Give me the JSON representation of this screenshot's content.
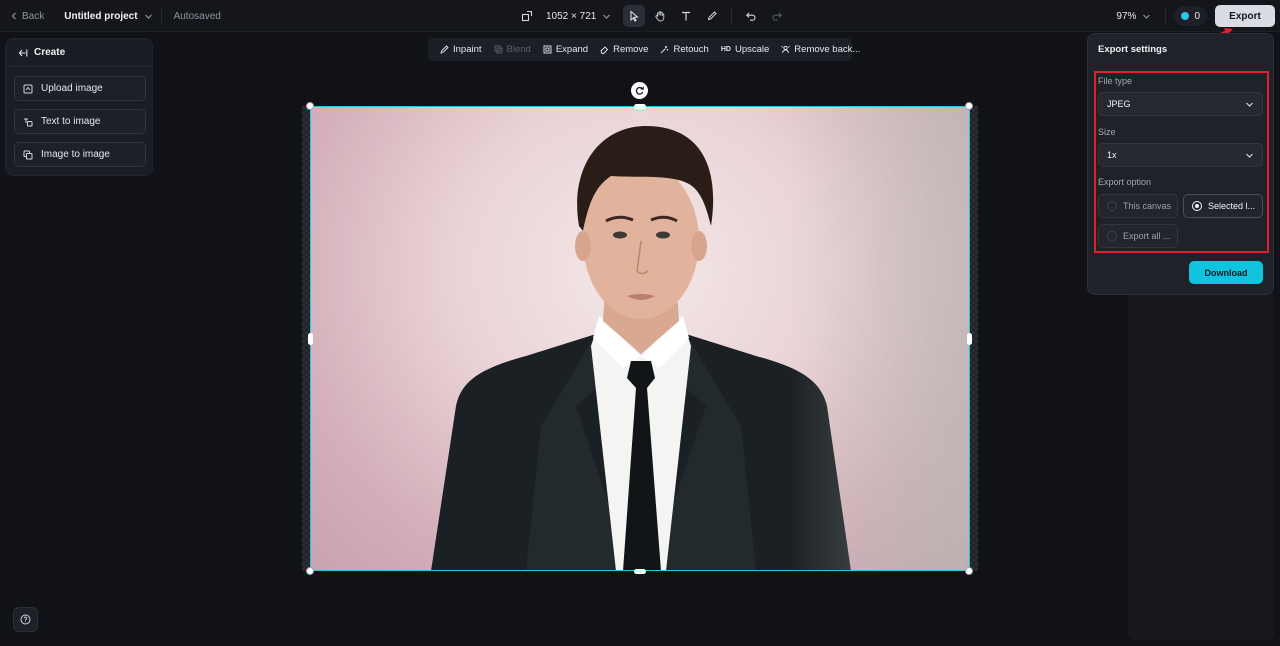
{
  "topbar": {
    "back_label": "Back",
    "project_title": "Untitled project",
    "autosaved": "Autosaved",
    "canvas_size": "1052 × 721",
    "zoom": "97%",
    "credits": "0",
    "export_label": "Export"
  },
  "create_panel": {
    "title": "Create",
    "items": [
      {
        "label": "Upload image",
        "icon": "upload-image-icon"
      },
      {
        "label": "Text to image",
        "icon": "text-to-image-icon"
      },
      {
        "label": "Image to image",
        "icon": "image-to-image-icon"
      }
    ]
  },
  "edit_toolbar": {
    "tools": [
      {
        "label": "Inpaint",
        "icon": "brush-icon",
        "disabled": false
      },
      {
        "label": "Blend",
        "icon": "blend-icon",
        "disabled": true
      },
      {
        "label": "Expand",
        "icon": "expand-icon",
        "disabled": false
      },
      {
        "label": "Remove",
        "icon": "eraser-icon",
        "disabled": false
      },
      {
        "label": "Retouch",
        "icon": "sparkle-icon",
        "disabled": false
      },
      {
        "label": "Upscale",
        "icon": "hd-icon",
        "disabled": false
      },
      {
        "label": "Remove back...",
        "icon": "remove-background-icon",
        "disabled": false
      }
    ]
  },
  "export_settings": {
    "title": "Export settings",
    "file_type_label": "File type",
    "file_type_value": "JPEG",
    "size_label": "Size",
    "size_value": "1x",
    "export_option_label": "Export option",
    "options": [
      {
        "label": "This canvas",
        "selected": false
      },
      {
        "label": "Selected l...",
        "selected": true
      },
      {
        "label": "Export all ...",
        "selected": false
      }
    ],
    "download_label": "Download"
  },
  "colors": {
    "accent": "#10c4e0",
    "selection": "#1fc7e3",
    "highlight_box": "#e0202e"
  }
}
